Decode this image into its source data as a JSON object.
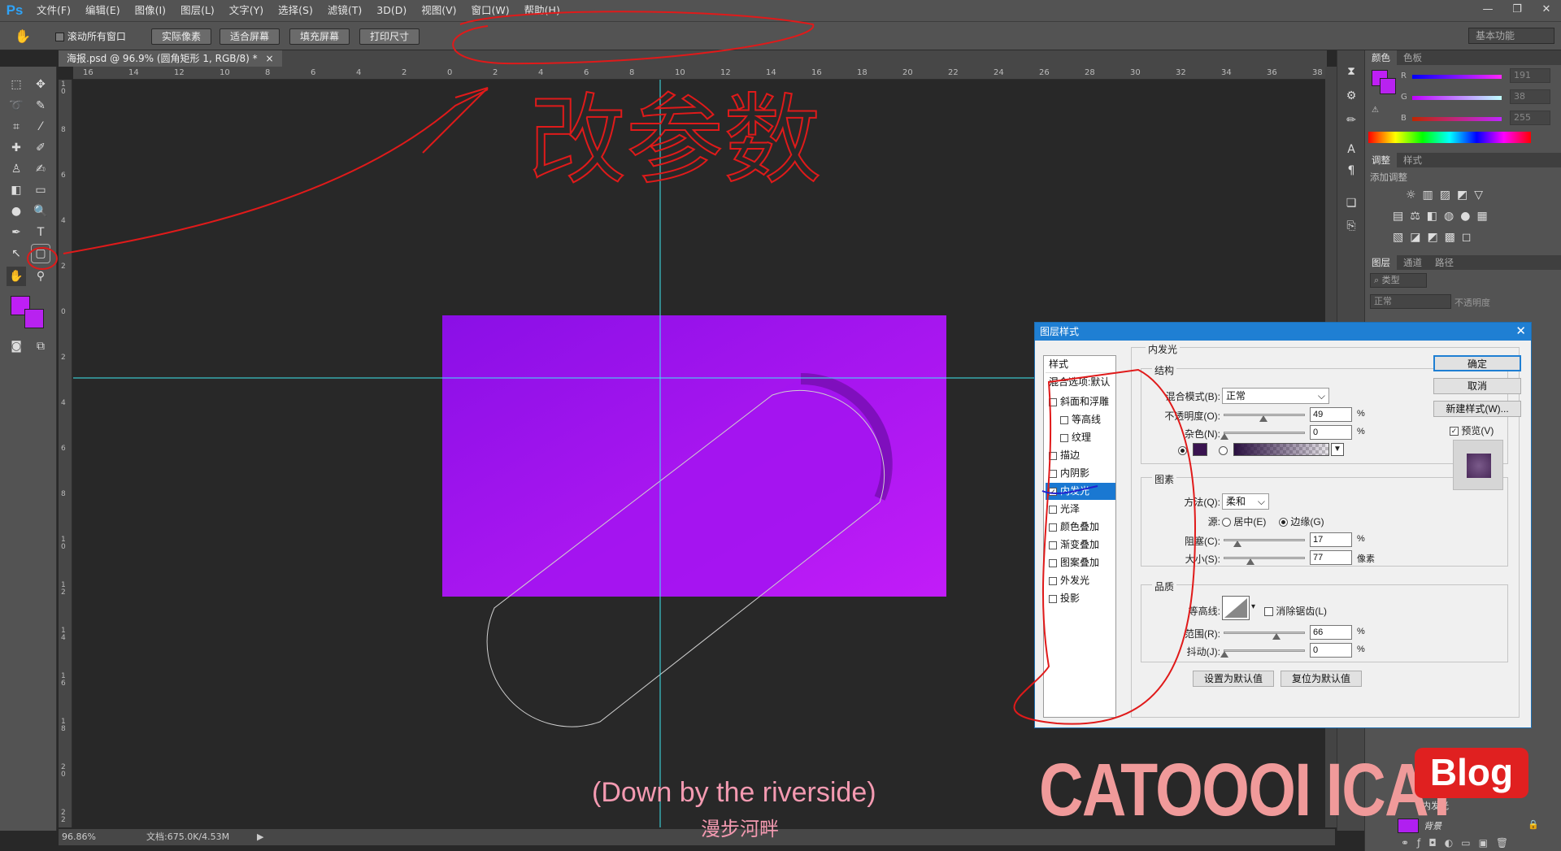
{
  "app": {
    "logo": "Ps"
  },
  "menu": [
    "文件(F)",
    "编辑(E)",
    "图像(I)",
    "图层(L)",
    "文字(Y)",
    "选择(S)",
    "滤镜(T)",
    "3D(D)",
    "视图(V)",
    "窗口(W)",
    "帮助(H)"
  ],
  "window_controls": [
    "—",
    "❐",
    "✕"
  ],
  "options": {
    "scroll_all": "滚动所有窗口",
    "buttons": [
      "实际像素",
      "适合屏幕",
      "填充屏幕",
      "打印尺寸"
    ],
    "workspace": "基本功能"
  },
  "document": {
    "tab": "海报.psd @ 96.9% (圆角矩形 1, RGB/8) *",
    "zoom": "96.86%",
    "doc_size": "文档:675.0K/4.53M"
  },
  "ruler": {
    "h": [
      "16",
      "14",
      "12",
      "10",
      "8",
      "6",
      "4",
      "2",
      "0",
      "2",
      "4",
      "6",
      "8",
      "10",
      "12",
      "14",
      "16",
      "18",
      "20",
      "22",
      "24",
      "26",
      "28",
      "30",
      "32",
      "34",
      "36",
      "38"
    ],
    "v": [
      "10",
      "8",
      "6",
      "4",
      "2",
      "0",
      "2",
      "4",
      "6",
      "8",
      "10",
      "12",
      "14",
      "16",
      "18",
      "20",
      "22"
    ]
  },
  "colors": {
    "foreground": "#bf1ff5",
    "background": "#b822f0",
    "canvas_top": "#8a0fe6",
    "canvas_bottom": "#c21cf8"
  },
  "color_panel": {
    "tabs": [
      "颜色",
      "色板"
    ],
    "channels": [
      {
        "name": "R",
        "value": "191"
      },
      {
        "name": "G",
        "value": "38"
      },
      {
        "name": "B",
        "value": "255"
      }
    ]
  },
  "adjust_panel": {
    "tabs": [
      "调整",
      "样式"
    ],
    "title": "添加调整"
  },
  "layers_panel": {
    "tabs": [
      "图层",
      "通道",
      "路径"
    ],
    "filter": "类型",
    "blend": "正常",
    "opacity_label": "不透明度",
    "layers": [
      "内发光",
      "背景"
    ]
  },
  "handwriting": {
    "text": "改参数"
  },
  "dialog": {
    "title": "图层样式",
    "styles_header": "样式",
    "blend_options": "混合选项:默认",
    "items": [
      {
        "label": "斜面和浮雕",
        "checked": false,
        "indent": false
      },
      {
        "label": "等高线",
        "checked": false,
        "indent": true
      },
      {
        "label": "纹理",
        "checked": false,
        "indent": true
      },
      {
        "label": "描边",
        "checked": false,
        "indent": false
      },
      {
        "label": "内阴影",
        "checked": false,
        "indent": false
      },
      {
        "label": "内发光",
        "checked": true,
        "indent": false,
        "selected": true
      },
      {
        "label": "光泽",
        "checked": false,
        "indent": false
      },
      {
        "label": "颜色叠加",
        "checked": false,
        "indent": false
      },
      {
        "label": "渐变叠加",
        "checked": false,
        "indent": false
      },
      {
        "label": "图案叠加",
        "checked": false,
        "indent": false
      },
      {
        "label": "外发光",
        "checked": false,
        "indent": false
      },
      {
        "label": "投影",
        "checked": false,
        "indent": false
      }
    ],
    "section": "内发光",
    "structure": {
      "title": "结构",
      "blend_mode_label": "混合模式(B):",
      "blend_mode": "正常",
      "opacity_label": "不透明度(O):",
      "opacity": "49",
      "noise_label": "杂色(N):",
      "noise": "0",
      "unit_pct": "%",
      "glow_color": "#3a1450"
    },
    "elements": {
      "title": "图素",
      "method_label": "方法(Q):",
      "method": "柔和",
      "source_label": "源:",
      "source_center": "居中(E)",
      "source_edge": "边缘(G)",
      "choke_label": "阻塞(C):",
      "choke": "17",
      "size_label": "大小(S):",
      "size": "77",
      "size_unit": "像素"
    },
    "quality": {
      "title": "品质",
      "contour_label": "等高线:",
      "antialias": "消除锯齿(L)",
      "range_label": "范围(R):",
      "range": "66",
      "jitter_label": "抖动(J):",
      "jitter": "0"
    },
    "make_default": "设置为默认值",
    "reset_default": "复位为默认值",
    "ok": "确定",
    "cancel": "取消",
    "new_style": "新建样式(W)...",
    "preview": "预览(V)"
  },
  "captions": {
    "en": "(Down by the riverside)",
    "zh": "漫步河畔"
  },
  "watermark": {
    "text": "CATOOOI ICAT",
    "badge": "Blog"
  }
}
